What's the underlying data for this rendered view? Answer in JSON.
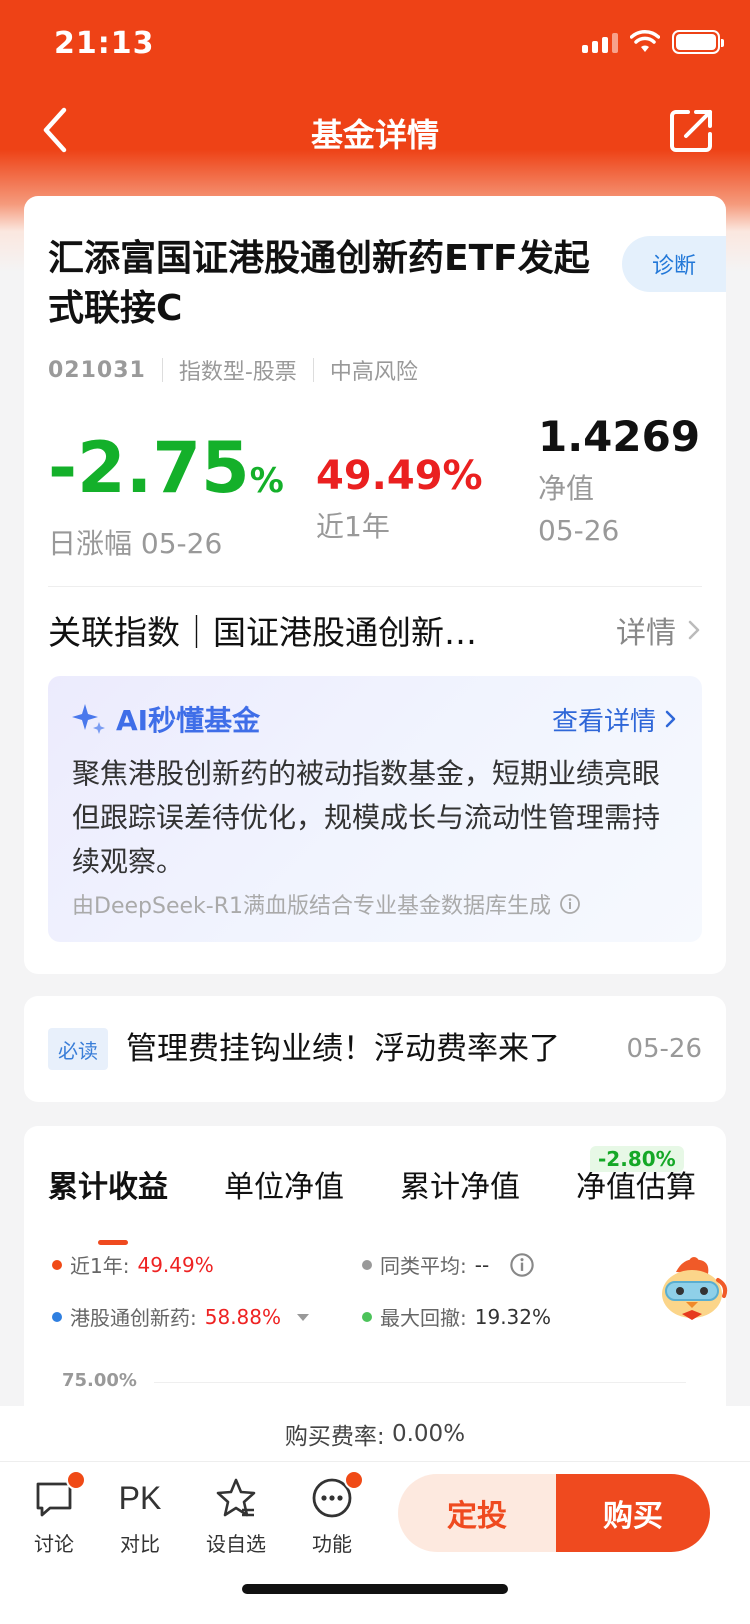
{
  "status_bar": {
    "time": "21:13"
  },
  "nav": {
    "title": "基金详情"
  },
  "fund": {
    "name": "汇添富国证港股通创新药ETF发起式联接C",
    "diagnose_label": "诊断",
    "code": "021031",
    "type": "指数型-股票",
    "risk": "中高风险"
  },
  "stats": {
    "daily_change": {
      "value": "-2.75",
      "unit": "%",
      "label": "日涨幅 05-26"
    },
    "year_return": {
      "value": "49.49%",
      "label": "近1年"
    },
    "nav": {
      "value": "1.4269",
      "label": "净值",
      "date": "05-26"
    }
  },
  "related_index": {
    "text": "关联指数｜国证港股通创新…",
    "more_label": "详情"
  },
  "ai_summary": {
    "title": "AI秒懂基金",
    "link_label": "查看详情",
    "text": "聚焦港股创新药的被动指数基金，短期业绩亮眼但跟踪误差待优化，规模成长与流动性管理需持续观察。",
    "footnote": "由DeepSeek-R1满血版结合专业基金数据库生成"
  },
  "news": {
    "tag": "必读",
    "title": "管理费挂钩业绩！浮动费率来了",
    "date": "05-26"
  },
  "chart_section": {
    "tabs": [
      "累计收益",
      "单位净值",
      "累计净值",
      "净值估算"
    ],
    "estimate_badge": "-2.80%",
    "legend": [
      {
        "label": "近1年:",
        "value": "49.49%",
        "color": "#f04a16"
      },
      {
        "label": "同类平均:",
        "value": "--",
        "color": "#999999"
      },
      {
        "label": "港股通创新药:",
        "value": "58.88%",
        "color": "#2f7fe0"
      },
      {
        "label": "最大回撤:",
        "value": "19.32%",
        "color": "#4cc35a"
      }
    ],
    "y_axis_top": "75.00%"
  },
  "buy_rate": {
    "label": "购买费率:",
    "value": "0.00%"
  },
  "bottom_bar": {
    "items": [
      {
        "label": "讨论",
        "icon": "chat-icon"
      },
      {
        "label": "对比",
        "icon": "PK"
      },
      {
        "label": "设自选",
        "icon": "star-icon"
      },
      {
        "label": "功能",
        "icon": "more-icon"
      }
    ],
    "sip_label": "定投",
    "buy_label": "购买"
  },
  "colors": {
    "brand": "#ee4216",
    "up": "#ea2020",
    "down": "#14b02a",
    "link": "#2f67d8"
  }
}
